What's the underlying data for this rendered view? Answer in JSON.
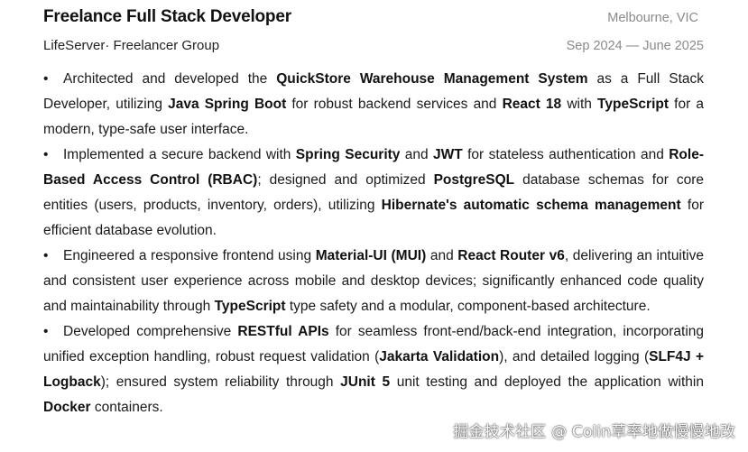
{
  "header": {
    "job_title": "Freelance Full Stack Developer",
    "location": "Melbourne, VIC",
    "company": "LifeServer· Freelancer Group",
    "dates": "Sep 2024 — June 2025"
  },
  "bullets": [
    [
      {
        "t": "Architected and developed the ",
        "b": false
      },
      {
        "t": "QuickStore Warehouse Management System",
        "b": true
      },
      {
        "t": " as a Full Stack Developer, utilizing ",
        "b": false
      },
      {
        "t": "Java Spring Boot",
        "b": true
      },
      {
        "t": " for robust backend services and ",
        "b": false
      },
      {
        "t": "React 18",
        "b": true
      },
      {
        "t": " with ",
        "b": false
      },
      {
        "t": "TypeScript",
        "b": true
      },
      {
        "t": " for a modern, type-safe user interface.",
        "b": false
      }
    ],
    [
      {
        "t": "Implemented a secure backend with ",
        "b": false
      },
      {
        "t": "Spring Security",
        "b": true
      },
      {
        "t": " and ",
        "b": false
      },
      {
        "t": "JWT",
        "b": true
      },
      {
        "t": " for stateless authentication and ",
        "b": false
      },
      {
        "t": "Role-Based Access Control (RBAC)",
        "b": true
      },
      {
        "t": "; designed and optimized ",
        "b": false
      },
      {
        "t": "PostgreSQL",
        "b": true
      },
      {
        "t": " database schemas for core entities (users, products, inventory, orders), utilizing ",
        "b": false
      },
      {
        "t": "Hibernate's automatic schema management",
        "b": true
      },
      {
        "t": " for efficient database evolution.",
        "b": false
      }
    ],
    [
      {
        "t": "Engineered a responsive frontend using ",
        "b": false
      },
      {
        "t": "Material-UI (MUI)",
        "b": true
      },
      {
        "t": " and ",
        "b": false
      },
      {
        "t": "React Router v6",
        "b": true
      },
      {
        "t": ", delivering an intuitive and consistent user experience across mobile and desktop devices; significantly enhanced code quality and maintainability through ",
        "b": false
      },
      {
        "t": "TypeScript",
        "b": true
      },
      {
        "t": " type safety and a modular, component-based architecture.",
        "b": false
      }
    ],
    [
      {
        "t": "Developed comprehensive ",
        "b": false
      },
      {
        "t": "RESTful APIs",
        "b": true
      },
      {
        "t": " for seamless front-end/back-end integration, incorporating unified exception handling, robust request validation (",
        "b": false
      },
      {
        "t": "Jakarta Validation",
        "b": true
      },
      {
        "t": "), and detailed logging (",
        "b": false
      },
      {
        "t": "SLF4J + Logback",
        "b": true
      },
      {
        "t": "); ensured system reliability through ",
        "b": false
      },
      {
        "t": "JUnit 5",
        "b": true
      },
      {
        "t": " unit testing and deployed the application within ",
        "b": false
      },
      {
        "t": "Docker",
        "b": true
      },
      {
        "t": " containers.",
        "b": false
      }
    ]
  ],
  "bullet_marker": "•",
  "watermark": "掘金技术社区 @ Colin草率地做慢慢地改"
}
